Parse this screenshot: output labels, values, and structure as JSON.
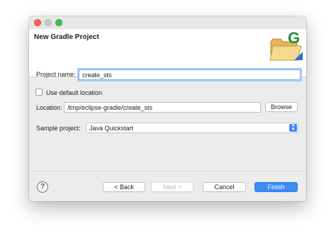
{
  "window": {
    "title": "New Gradle Project"
  },
  "header": {
    "icon": "gradle-folder-icon",
    "logo_letter": "G"
  },
  "form": {
    "project_name_label": "Project name:",
    "project_name_value": "create_sts",
    "use_default_label": "Use default location",
    "use_default_checked": false,
    "location_label": "Location:",
    "location_value": "/tmp/eclipse-gradle/create_sts",
    "browse_label": "Browse",
    "sample_label": "Sample project:",
    "sample_value": "Java Quickstart"
  },
  "footer": {
    "help_icon": "question-mark-icon",
    "help_glyph": "?",
    "back_label": "< Back",
    "next_label": "Next >",
    "cancel_label": "Cancel",
    "finish_label": "Finish"
  },
  "colors": {
    "accent": "#3b8df5",
    "focus": "#a9cdf7",
    "gradle_green": "#1f8a3a"
  }
}
